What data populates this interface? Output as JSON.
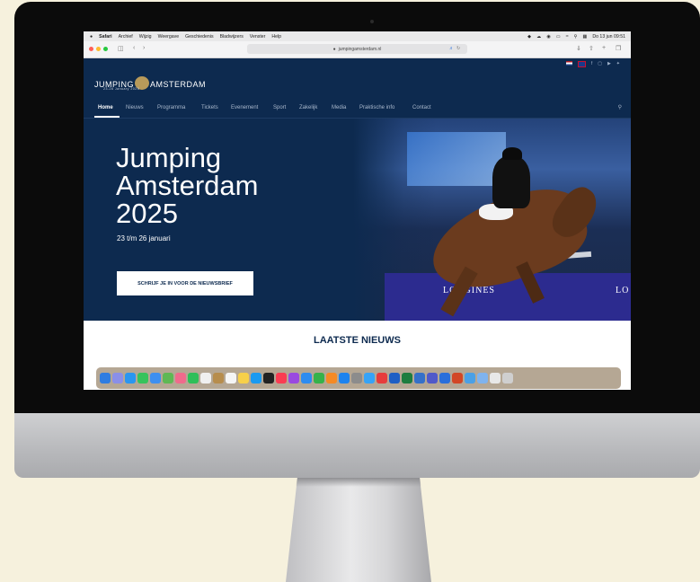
{
  "menubar": {
    "apple": "",
    "app": "Safari",
    "items": [
      "Archief",
      "Wijzig",
      "Weergave",
      "Geschiedenis",
      "Bladwijzers",
      "Venster",
      "Help"
    ],
    "clock": "Do 13 jun 09:51"
  },
  "toolbar": {
    "url": "jumpingamsterdam.nl"
  },
  "site": {
    "logo_text_left": "JUMPING",
    "logo_text_right": "AMSTERDAM",
    "logo_sub": "23-26 January 2025",
    "nav": [
      "Home",
      "Nieuws",
      "Programma",
      "Tickets",
      "Evenement",
      "Sport",
      "Zakelijk",
      "Media",
      "Praktische info",
      "Contact"
    ],
    "hero_title": "Jumping Amsterdam 2025",
    "hero_dates": "23 t/m 26 januari",
    "cta_label": "SCHRIJF JE IN VOOR DE NIEUWSBRIEF",
    "sponsor": "LONGINES",
    "sponsor2": "LO",
    "news_heading": "LAATSTE NIEUWS"
  },
  "colors": {
    "brand_navy": "#0d2a4f",
    "cta_bg": "#ffffff"
  }
}
